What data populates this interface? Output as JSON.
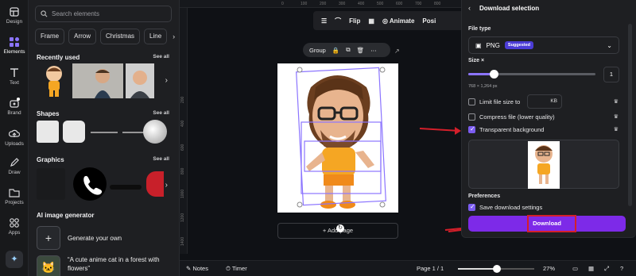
{
  "rail": {
    "items": [
      {
        "label": "Design",
        "icon": "design-icon"
      },
      {
        "label": "Elements",
        "icon": "elements-icon"
      },
      {
        "label": "Text",
        "icon": "text-icon"
      },
      {
        "label": "Brand",
        "icon": "brand-icon"
      },
      {
        "label": "Uploads",
        "icon": "uploads-icon"
      },
      {
        "label": "Draw",
        "icon": "draw-icon"
      },
      {
        "label": "Projects",
        "icon": "projects-icon"
      },
      {
        "label": "Apps",
        "icon": "apps-icon"
      }
    ]
  },
  "elements_panel": {
    "search_placeholder": "Search elements",
    "chips": [
      "Frame",
      "Arrow",
      "Christmas",
      "Line"
    ],
    "recently_used": {
      "title": "Recently used",
      "see_all": "See all"
    },
    "shapes": {
      "title": "Shapes",
      "see_all": "See all"
    },
    "graphics": {
      "title": "Graphics",
      "see_all": "See all"
    },
    "ai_generator": {
      "title": "AI image generator",
      "generate_label": "Generate your own",
      "prompt_line1": "“A cute anime cat in a forest with",
      "prompt_line2": "flowers”"
    }
  },
  "canvas": {
    "ruler_top": [
      "0",
      "100",
      "200",
      "300",
      "400",
      "500",
      "600",
      "700",
      "800"
    ],
    "ruler_left": [
      "200",
      "400",
      "600",
      "800",
      "1000",
      "1200",
      "1400"
    ],
    "toolbar": {
      "flip": "Flip",
      "animate": "Animate",
      "position": "Posi"
    },
    "group_label": "Group",
    "add_page": "+ Add page",
    "bottom": {
      "notes": "Notes",
      "timer": "Timer",
      "page": "Page 1 / 1",
      "zoom": "27%",
      "zoom_fraction": 0.5
    }
  },
  "download": {
    "header": "Download selection",
    "file_type_label": "File type",
    "file_type_value": "PNG",
    "suggested_badge": "Suggested",
    "size_label": "Size ×",
    "size_value": "1",
    "size_fraction": 0.2,
    "dimensions": "768 × 1,264 px",
    "options": [
      {
        "label": "Limit file size to",
        "checked": false,
        "crown": true
      },
      {
        "label": "Compress file (lower quality)",
        "checked": false,
        "crown": true
      },
      {
        "label": "Transparent background",
        "checked": true,
        "crown": true
      }
    ],
    "kb_unit": "KB",
    "preferences_label": "Preferences",
    "save_settings_label": "Save download settings",
    "download_button": "Download"
  },
  "colors": {
    "accent": "#7d2ae8",
    "badge": "#4b3cd6",
    "annotation_red": "#d41f2a"
  }
}
